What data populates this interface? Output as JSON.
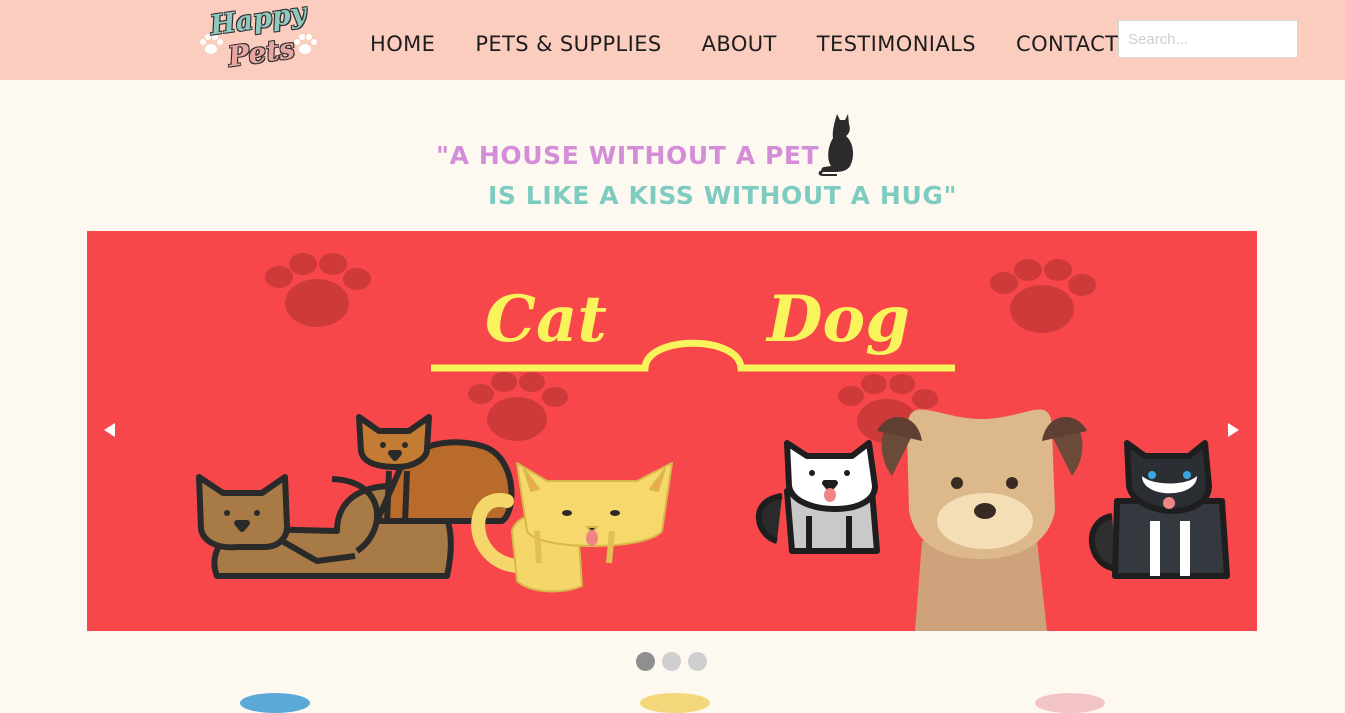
{
  "logo": {
    "line1": "Happy",
    "line2": "Pets"
  },
  "nav": {
    "items": [
      {
        "label": "HOME"
      },
      {
        "label": "PETS & SUPPLIES"
      },
      {
        "label": "ABOUT"
      },
      {
        "label": "TESTIMONIALS"
      },
      {
        "label": "CONTACT"
      }
    ]
  },
  "search": {
    "placeholder": "Search..."
  },
  "quote": {
    "line1": "\"A HOUSE WITHOUT A PET",
    "line2": "IS LIKE A KISS WITHOUT A HUG\""
  },
  "slider": {
    "banner_left": "Cat",
    "banner_right": "Dog",
    "slide_count": 3,
    "active_slide": 1
  },
  "colors": {
    "header_bg": "#fbcdbf",
    "page_bg": "#fdf9f1",
    "slider_bg": "#f8474a",
    "banner_yellow": "#f9f35c",
    "quote_purple": "#d48ed7",
    "quote_teal": "#7ecbc0"
  },
  "icons": {
    "prev": "triangle-left-icon",
    "next": "triangle-right-icon",
    "quote_decoration": "cat-silhouette-icon"
  }
}
